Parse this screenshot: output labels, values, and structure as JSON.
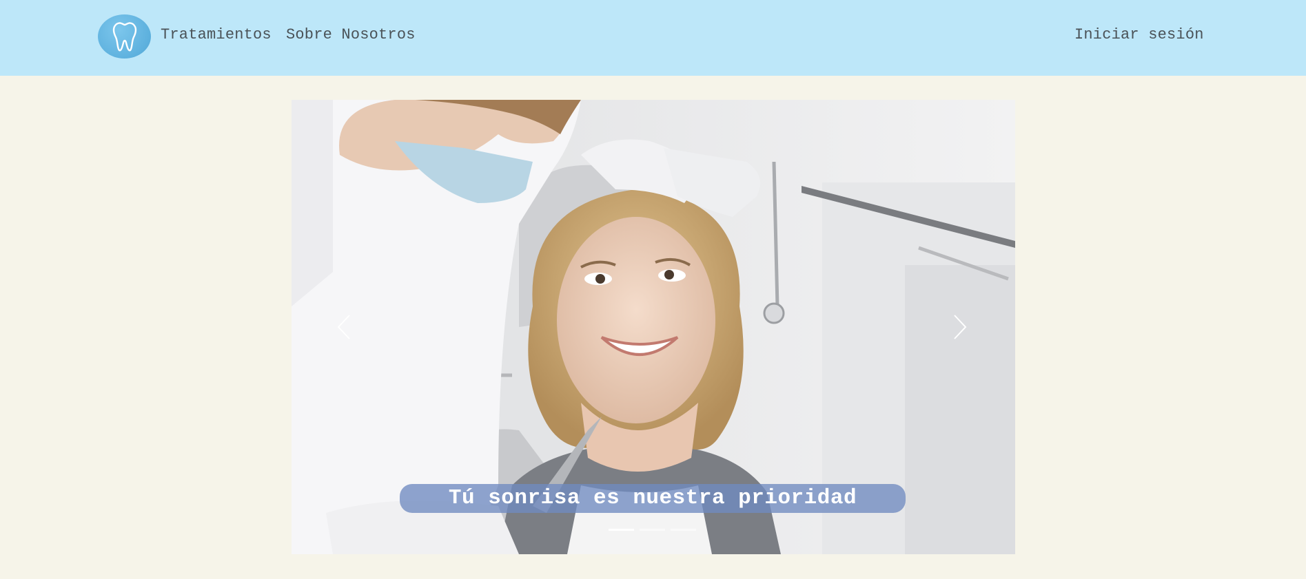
{
  "header": {
    "logo_icon": "tooth-icon",
    "nav": {
      "treatments_label": "Tratamientos",
      "about_label": "Sobre Nosotros"
    },
    "login_label": "Iniciar sesión"
  },
  "carousel": {
    "caption": "Tú sonrisa es nuestra prioridad",
    "prev_icon": "chevron-left-icon",
    "next_icon": "chevron-right-icon",
    "slide_count": 3,
    "active_slide": 1,
    "image_subject": "dental-patient-photo"
  },
  "colors": {
    "header_bg": "#bde7f9",
    "page_bg": "#f6f4e9",
    "logo_bg": "#5eb1de",
    "caption_bg": "#708ac0",
    "nav_text": "#4a5257"
  }
}
